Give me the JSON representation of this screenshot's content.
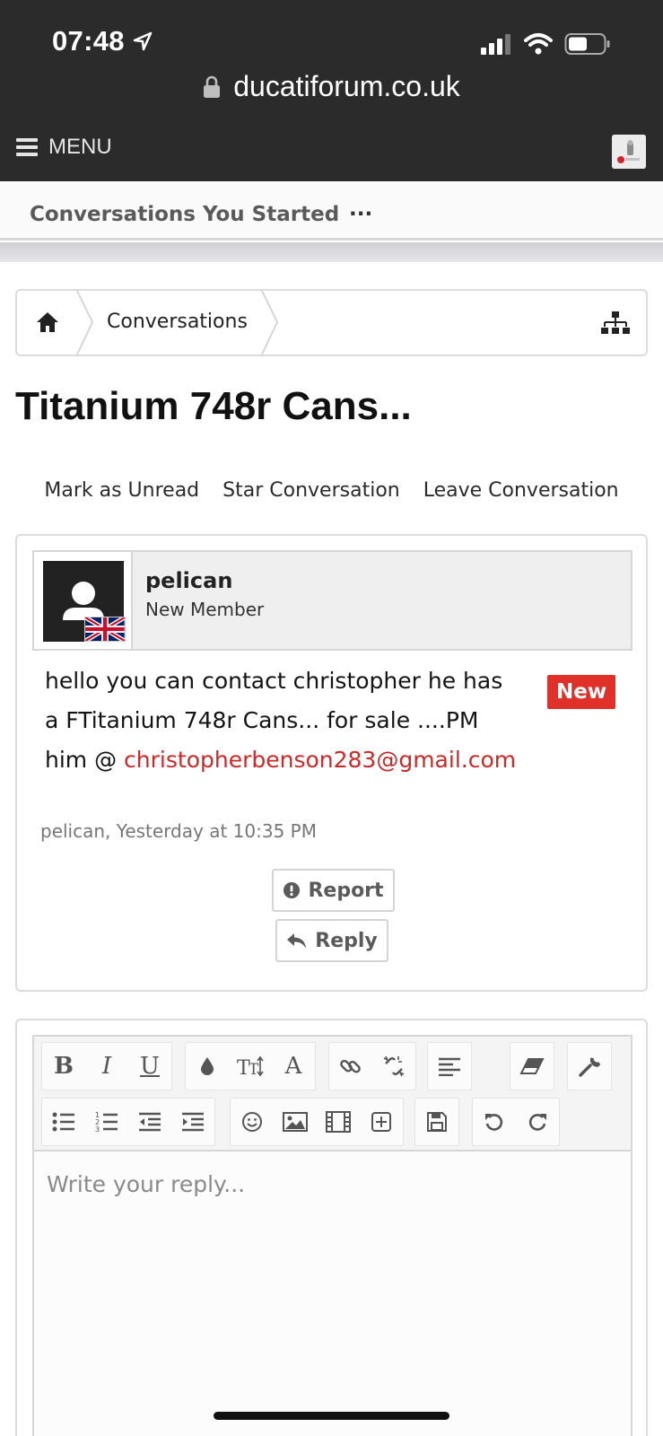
{
  "status": {
    "time": "07:48"
  },
  "browser": {
    "url": "ducatiforum.co.uk"
  },
  "nav": {
    "menu_label": "MENU"
  },
  "subnav": {
    "tab": "Conversations You Started",
    "more": "..."
  },
  "breadcrumb": {
    "item": "Conversations"
  },
  "page": {
    "title": "Titanium 748r Cans..."
  },
  "actions": [
    "Mark as Unread",
    "Star Conversation",
    "Leave Conversation"
  ],
  "message": {
    "author": "pelican",
    "role": "New Member",
    "badge": "New",
    "text_line1": "hello you can contact christopher he has",
    "text_line2": "a FTitanium 748r Cans... for sale ....PM",
    "text_line3_prefix": "him @ ",
    "email": "christopherbenson283@gmail.com",
    "meta": "pelican, Yesterday at 10:35 PM",
    "report_label": "Report",
    "reply_label": "Reply"
  },
  "editor": {
    "placeholder": "Write your reply..."
  },
  "colors": {
    "accent_red": "#df3029",
    "link_red": "#c92b2b",
    "topbar": "#2b2b2b"
  }
}
